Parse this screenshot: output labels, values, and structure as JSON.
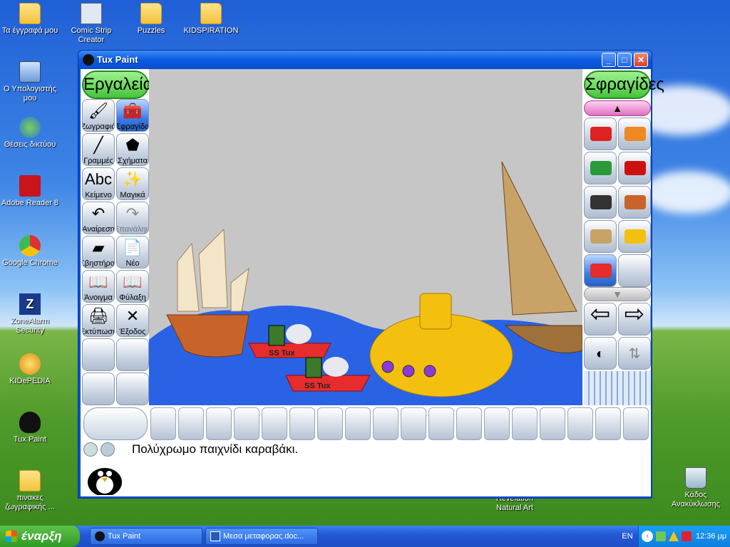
{
  "desktop": {
    "icons": [
      {
        "label": "Τα έγγραφά μου",
        "icon": "folder-icon"
      },
      {
        "label": "Comic Strip Creator",
        "icon": "comic-strip-icon"
      },
      {
        "label": "Puzzles",
        "icon": "folder-icon"
      },
      {
        "label": "KIDSPIRATION",
        "icon": "folder-icon"
      },
      {
        "label": "Ο Υπολογιστής μου",
        "icon": "computer-icon"
      },
      {
        "label": "Θέσεις δικτύου",
        "icon": "network-icon"
      },
      {
        "label": "Adobe Reader 8",
        "icon": "adobe-reader-icon"
      },
      {
        "label": "Google Chrome",
        "icon": "chrome-icon"
      },
      {
        "label": "ZoneAlarm Security",
        "icon": "zonealarm-icon"
      },
      {
        "label": "KIDePEDIA",
        "icon": "kidepedia-icon"
      },
      {
        "label": "Tux Paint",
        "icon": "tux-icon"
      },
      {
        "label": "πινακες ζωγραφικής ...",
        "icon": "folder-icon"
      },
      {
        "label": "Κάδος Ανακύκλωσης",
        "icon": "recycle-bin-icon"
      },
      {
        "label": "Revelation Natural Art",
        "icon": "revelation-icon"
      }
    ]
  },
  "window": {
    "title": "Tux Paint",
    "controls": [
      "_",
      "□",
      "✕"
    ]
  },
  "tools": {
    "header": "Εργαλεία",
    "items": [
      {
        "label": "Ζωγραφιά",
        "glyph": "🖌",
        "state": "normal"
      },
      {
        "label": "Σφραγίδα",
        "glyph": "🧰",
        "state": "selected"
      },
      {
        "label": "Γραμμές",
        "glyph": "╱",
        "state": "normal"
      },
      {
        "label": "Σχήματα",
        "glyph": "⬟",
        "state": "normal"
      },
      {
        "label": "Κείμενο",
        "glyph": "Abc",
        "state": "normal"
      },
      {
        "label": "Μαγικά",
        "glyph": "✨",
        "state": "normal"
      },
      {
        "label": "Αναίρεση",
        "glyph": "↶",
        "state": "normal"
      },
      {
        "label": "Επανάληψη",
        "glyph": "↷",
        "state": "disabled"
      },
      {
        "label": "Σβηστήρας",
        "glyph": "▰",
        "state": "normal"
      },
      {
        "label": "Νέο",
        "glyph": "📄",
        "state": "normal"
      },
      {
        "label": "Άνοιγμα",
        "glyph": "📖",
        "state": "normal"
      },
      {
        "label": "Φύλαξη",
        "glyph": "📖",
        "state": "normal"
      },
      {
        "label": "Εκτύπωση",
        "glyph": "🖨",
        "state": "normal"
      },
      {
        "label": "Έξοδος",
        "glyph": "✕",
        "state": "normal"
      }
    ]
  },
  "stamps": {
    "header": "Σφραγίδες",
    "items": [
      {
        "name": "train-stamp"
      },
      {
        "name": "warning-sign-stamp"
      },
      {
        "name": "bus-stamp"
      },
      {
        "name": "double-decker-bus-stamp"
      },
      {
        "name": "car-stamp"
      },
      {
        "name": "junk-ship-stamp"
      },
      {
        "name": "sailboat-stamp"
      },
      {
        "name": "submarine-stamp"
      },
      {
        "name": "tux-boat-stamp",
        "selected": true
      },
      {
        "name": "empty-slot"
      }
    ]
  },
  "status": {
    "message": "Πολύχρωμο παιχνίδι καραβάκι."
  },
  "canvas": {
    "boat_label": "SS Tux"
  },
  "taskbar": {
    "start_label": "έναρξη",
    "tasks": [
      {
        "label": "Tux Paint",
        "icon": "tux-icon"
      },
      {
        "label": "Μεσα μεταφορας.doc...",
        "icon": "word-icon"
      }
    ],
    "tray": {
      "language": "EN",
      "time": "12:36 μμ"
    }
  },
  "colors": {
    "sea": "#2a62e6",
    "boat_red": "#e62c2c",
    "submarine": "#f4c010",
    "tool_header": "#55cc44"
  }
}
